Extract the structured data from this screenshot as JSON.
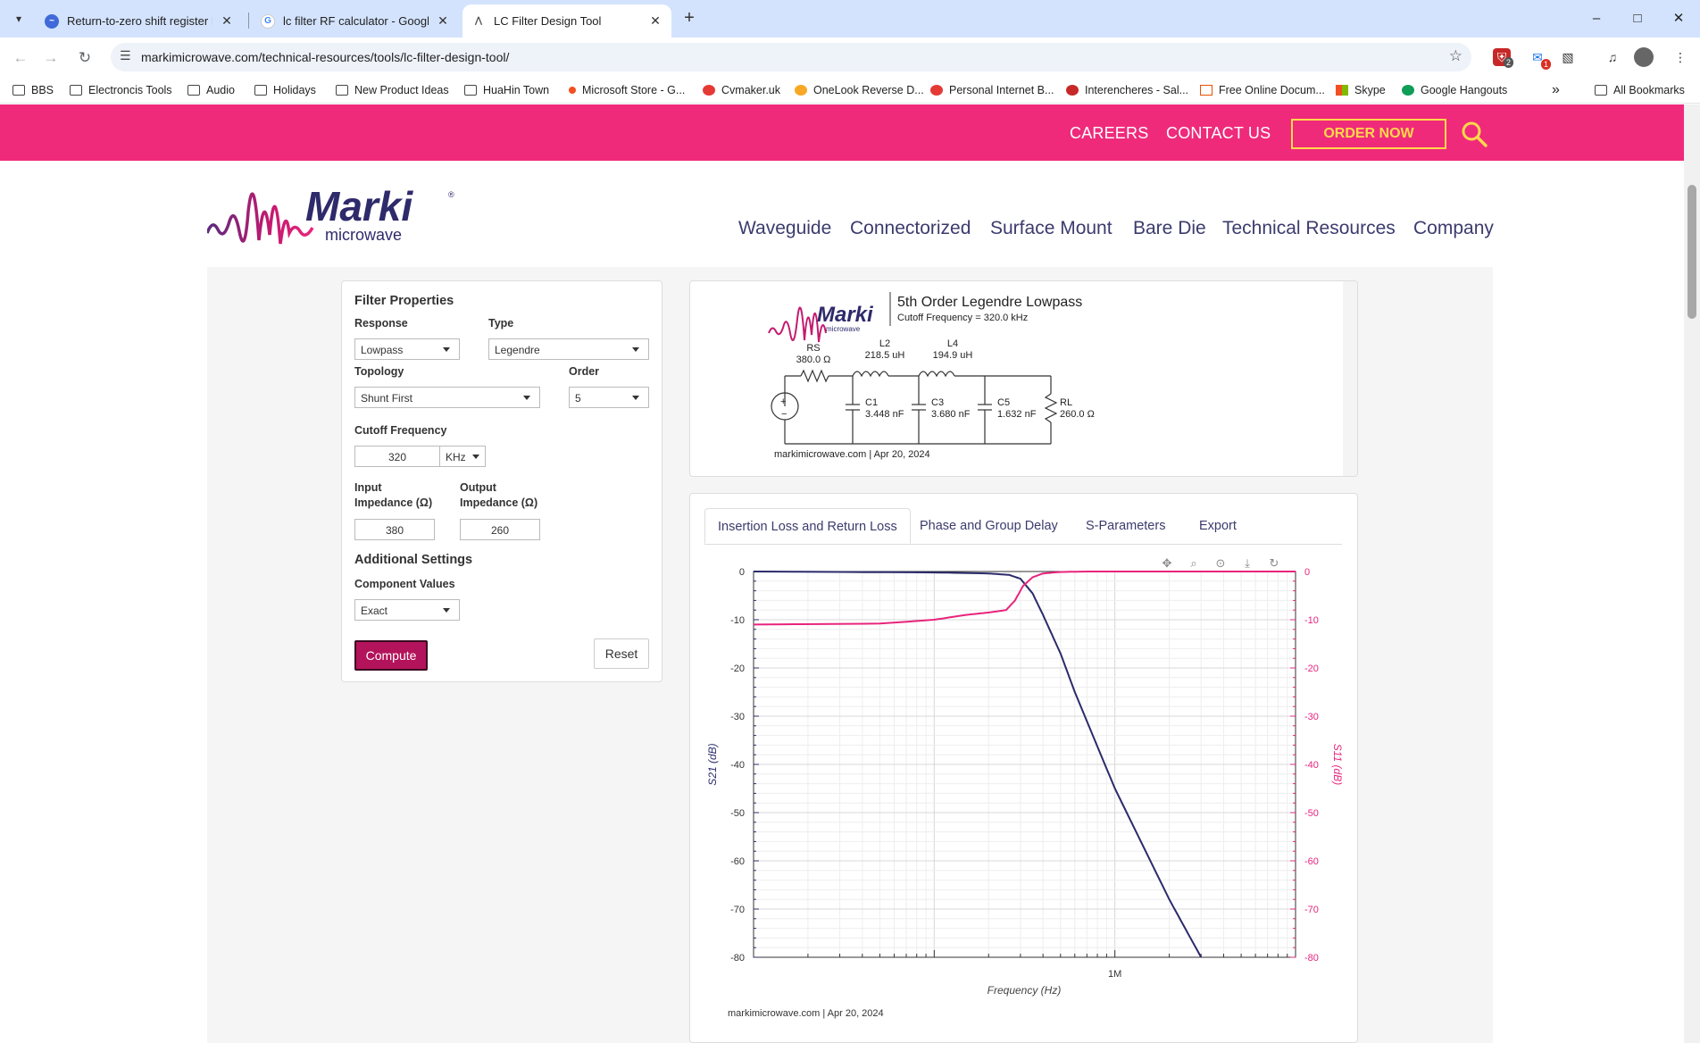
{
  "browser": {
    "tabs": [
      {
        "title": "Return-to-zero shift register Fl",
        "favicon": "globe-icon"
      },
      {
        "title": "lc filter RF calculator - Google",
        "favicon": "google-icon"
      },
      {
        "title": "LC Filter Design Tool",
        "favicon": "marki-icon",
        "active": true
      }
    ],
    "url": "markimicrowave.com/technical-resources/tools/lc-filter-design-tool/",
    "extension_badges": [
      "2",
      "1"
    ],
    "bookmarks": [
      "BBS",
      "Electroncis Tools",
      "Audio",
      "Holidays",
      "New Product Ideas",
      "HuaHin Town",
      "Microsoft Store - G...",
      "Cvmaker.uk",
      "OneLook Reverse D...",
      "Personal Internet B...",
      "Interencheres - Sal...",
      "Free Online Docum...",
      "Skype",
      "Google Hangouts"
    ],
    "all_bookmarks": "All Bookmarks",
    "more_bookmarks": "»"
  },
  "site": {
    "top_links": {
      "careers": "CAREERS",
      "contact": "CONTACT US",
      "order": "ORDER NOW"
    },
    "logo": {
      "word": "Marki",
      "sub": "microwave",
      "reg": "®"
    },
    "nav": [
      "Waveguide",
      "Connectorized",
      "Surface Mount",
      "Bare Die",
      "Technical Resources",
      "Company"
    ],
    "colors": {
      "brand_pink": "#ef2a7b",
      "order_yellow": "#ffd84a",
      "compute": "#b3135b",
      "s21": "#2b2a6b",
      "s11": "#e8247c"
    }
  },
  "form": {
    "title": "Filter Properties",
    "response_label": "Response",
    "response": "Lowpass",
    "type_label": "Type",
    "type": "Legendre",
    "topology_label": "Topology",
    "topology": "Shunt First",
    "order_label": "Order",
    "order": "5",
    "cutoff_label": "Cutoff Frequency",
    "cutoff": "320",
    "cutoff_unit": "KHz",
    "input_label_1": "Input",
    "input_label_2": "Impedance (Ω)",
    "input_impedance": "380",
    "output_label_1": "Output",
    "output_label_2": "Impedance (Ω)",
    "output_impedance": "260",
    "additional": "Additional Settings",
    "component_label": "Component Values",
    "component": "Exact",
    "compute": "Compute",
    "reset": "Reset"
  },
  "schematic": {
    "title": "5th Order Legendre Lowpass",
    "subtitle": "Cutoff Frequency = 320.0 kHz",
    "footer": "markimicrowave.com | Apr 20, 2024",
    "components": [
      {
        "name": "RS",
        "value": "380.0 Ω"
      },
      {
        "name": "L2",
        "value": "218.5 uH"
      },
      {
        "name": "L4",
        "value": "194.9 uH"
      },
      {
        "name": "C1",
        "value": "3.448 nF"
      },
      {
        "name": "C3",
        "value": "3.680 nF"
      },
      {
        "name": "C5",
        "value": "1.632 nF"
      },
      {
        "name": "RL",
        "value": "260.0 Ω"
      }
    ],
    "source_plus": "+",
    "source_minus": "−"
  },
  "chart_tabs": [
    "Insertion Loss and Return Loss",
    "Phase and Group Delay",
    "S-Parameters",
    "Export"
  ],
  "chart_footer": "markimicrowave.com | Apr 20, 2024",
  "chart_data": {
    "type": "line",
    "xlabel": "Frequency (Hz)",
    "ylabel_left": "S21 (dB)",
    "ylabel_right": "S11 (dB)",
    "x_scale": "log",
    "x_range": [
      10000,
      10000000
    ],
    "x_tick_labels": [
      {
        "value": 1000000,
        "label": "1M"
      }
    ],
    "ylim": [
      -80,
      0
    ],
    "y_ticks": [
      0,
      -10,
      -20,
      -30,
      -40,
      -50,
      -60,
      -70,
      -80
    ],
    "grid": true,
    "series": [
      {
        "name": "S21",
        "color": "#2b2a6b",
        "axis": "left",
        "x": [
          10000,
          100000,
          200000,
          260000,
          300000,
          350000,
          400000,
          500000,
          600000,
          1000000,
          2000000,
          3000000
        ],
        "y": [
          0,
          -0.2,
          -0.4,
          -0.7,
          -1.5,
          -4.5,
          -9,
          -17,
          -25,
          -45,
          -68,
          -80
        ]
      },
      {
        "name": "S11",
        "color": "#e8247c",
        "axis": "right",
        "x": [
          10000,
          50000,
          100000,
          150000,
          200000,
          250000,
          280000,
          310000,
          350000,
          400000,
          500000,
          700000,
          10000000
        ],
        "y": [
          -11,
          -10.8,
          -10,
          -9,
          -8.5,
          -8,
          -6,
          -3,
          -1.2,
          -0.4,
          -0.1,
          0,
          0
        ]
      }
    ]
  }
}
